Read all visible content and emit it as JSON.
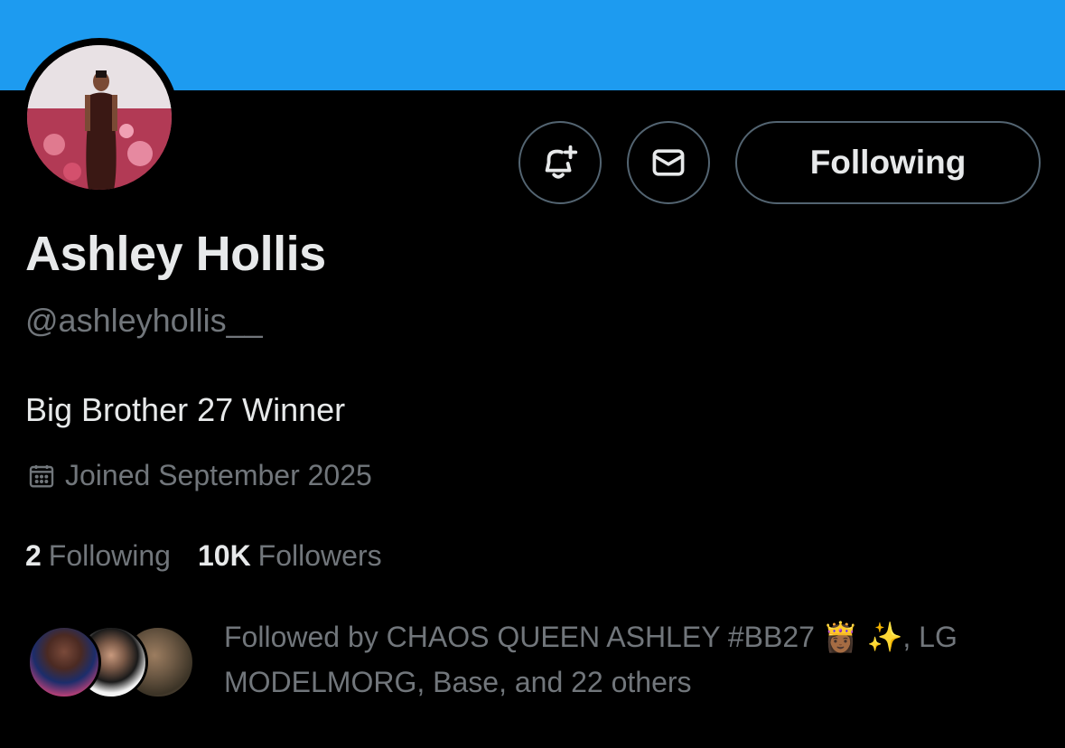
{
  "profile": {
    "display_name": "Ashley Hollis",
    "handle": "@ashleyhollis__",
    "bio": "Big Brother 27 Winner",
    "joined": "Joined September 2025",
    "following_count": "2",
    "following_label": "Following",
    "followers_count": "10K",
    "followers_label": "Followers",
    "followed_by": "Followed by CHAOS QUEEN ASHLEY #BB27 👸🏾 ✨, LG MODELMORG, Base, and 22 others"
  },
  "actions": {
    "follow_state_label": "Following"
  },
  "icons": {
    "notify": "bell-plus-icon",
    "message": "envelope-icon",
    "joined": "calendar-icon"
  },
  "colors": {
    "banner": "#1d9bf0",
    "background": "#000000",
    "primary_text": "#e7e9ea",
    "secondary_text": "#71767b",
    "button_border": "#536471"
  }
}
